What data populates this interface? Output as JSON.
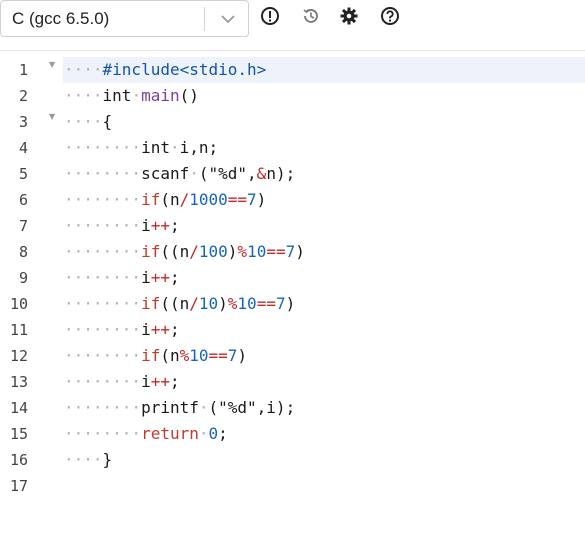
{
  "toolbar": {
    "language_label": "C (gcc 6.5.0)",
    "icons": [
      "alert-circle-icon",
      "history-icon",
      "gear-icon",
      "help-circle-icon"
    ]
  },
  "editor": {
    "lines": [
      {
        "num": "1",
        "indent": 1,
        "fold": true,
        "tokens": [
          {
            "t": "pre",
            "v": "#include<stdio.h>"
          }
        ]
      },
      {
        "num": "2",
        "indent": 1,
        "fold": false,
        "tokens": [
          {
            "t": "type",
            "v": "int"
          },
          {
            "t": "ws",
            "v": "·"
          },
          {
            "t": "fn",
            "v": "main"
          },
          {
            "t": "plain",
            "v": "()"
          }
        ]
      },
      {
        "num": "3",
        "indent": 1,
        "fold": true,
        "tokens": [
          {
            "t": "plain",
            "v": "{"
          }
        ]
      },
      {
        "num": "4",
        "indent": 2,
        "fold": false,
        "tokens": [
          {
            "t": "type",
            "v": "int"
          },
          {
            "t": "ws",
            "v": "·"
          },
          {
            "t": "plain",
            "v": "i,n;"
          }
        ]
      },
      {
        "num": "5",
        "indent": 2,
        "fold": false,
        "tokens": [
          {
            "t": "plain",
            "v": "scanf"
          },
          {
            "t": "ws",
            "v": "·"
          },
          {
            "t": "plain",
            "v": "(\"%d\","
          },
          {
            "t": "op",
            "v": "&"
          },
          {
            "t": "plain",
            "v": "n);"
          }
        ]
      },
      {
        "num": "6",
        "indent": 2,
        "fold": false,
        "tokens": [
          {
            "t": "kw",
            "v": "if"
          },
          {
            "t": "plain",
            "v": "(n"
          },
          {
            "t": "op",
            "v": "/"
          },
          {
            "t": "num",
            "v": "1000"
          },
          {
            "t": "op",
            "v": "=="
          },
          {
            "t": "num",
            "v": "7"
          },
          {
            "t": "plain",
            "v": ")"
          }
        ]
      },
      {
        "num": "7",
        "indent": 2,
        "fold": false,
        "tokens": [
          {
            "t": "plain",
            "v": "i"
          },
          {
            "t": "op",
            "v": "++"
          },
          {
            "t": "plain",
            "v": ";"
          }
        ]
      },
      {
        "num": "8",
        "indent": 2,
        "fold": false,
        "tokens": [
          {
            "t": "kw",
            "v": "if"
          },
          {
            "t": "plain",
            "v": "((n"
          },
          {
            "t": "op",
            "v": "/"
          },
          {
            "t": "num",
            "v": "100"
          },
          {
            "t": "plain",
            "v": ")"
          },
          {
            "t": "op",
            "v": "%"
          },
          {
            "t": "num",
            "v": "10"
          },
          {
            "t": "op",
            "v": "=="
          },
          {
            "t": "num",
            "v": "7"
          },
          {
            "t": "plain",
            "v": ")"
          }
        ]
      },
      {
        "num": "9",
        "indent": 2,
        "fold": false,
        "tokens": [
          {
            "t": "plain",
            "v": "i"
          },
          {
            "t": "op",
            "v": "++"
          },
          {
            "t": "plain",
            "v": ";"
          }
        ]
      },
      {
        "num": "10",
        "indent": 2,
        "fold": false,
        "tokens": [
          {
            "t": "kw",
            "v": "if"
          },
          {
            "t": "plain",
            "v": "((n"
          },
          {
            "t": "op",
            "v": "/"
          },
          {
            "t": "num",
            "v": "10"
          },
          {
            "t": "plain",
            "v": ")"
          },
          {
            "t": "op",
            "v": "%"
          },
          {
            "t": "num",
            "v": "10"
          },
          {
            "t": "op",
            "v": "=="
          },
          {
            "t": "num",
            "v": "7"
          },
          {
            "t": "plain",
            "v": ")"
          }
        ]
      },
      {
        "num": "11",
        "indent": 2,
        "fold": false,
        "tokens": [
          {
            "t": "plain",
            "v": "i"
          },
          {
            "t": "op",
            "v": "++"
          },
          {
            "t": "plain",
            "v": ";"
          }
        ]
      },
      {
        "num": "12",
        "indent": 2,
        "fold": false,
        "tokens": [
          {
            "t": "kw",
            "v": "if"
          },
          {
            "t": "plain",
            "v": "(n"
          },
          {
            "t": "op",
            "v": "%"
          },
          {
            "t": "num",
            "v": "10"
          },
          {
            "t": "op",
            "v": "=="
          },
          {
            "t": "num",
            "v": "7"
          },
          {
            "t": "plain",
            "v": ")"
          }
        ]
      },
      {
        "num": "13",
        "indent": 2,
        "fold": false,
        "tokens": [
          {
            "t": "plain",
            "v": "i"
          },
          {
            "t": "op",
            "v": "++"
          },
          {
            "t": "plain",
            "v": ";"
          }
        ]
      },
      {
        "num": "14",
        "indent": 2,
        "fold": false,
        "tokens": [
          {
            "t": "plain",
            "v": "printf"
          },
          {
            "t": "ws",
            "v": "·"
          },
          {
            "t": "plain",
            "v": "(\"%d\",i);"
          }
        ]
      },
      {
        "num": "15",
        "indent": 2,
        "fold": false,
        "tokens": [
          {
            "t": "kw",
            "v": "return"
          },
          {
            "t": "ws",
            "v": "·"
          },
          {
            "t": "num",
            "v": "0"
          },
          {
            "t": "plain",
            "v": ";"
          }
        ]
      },
      {
        "num": "16",
        "indent": 1,
        "fold": false,
        "tokens": [
          {
            "t": "plain",
            "v": "}"
          }
        ]
      },
      {
        "num": "17",
        "indent": 0,
        "fold": false,
        "tokens": []
      }
    ]
  }
}
